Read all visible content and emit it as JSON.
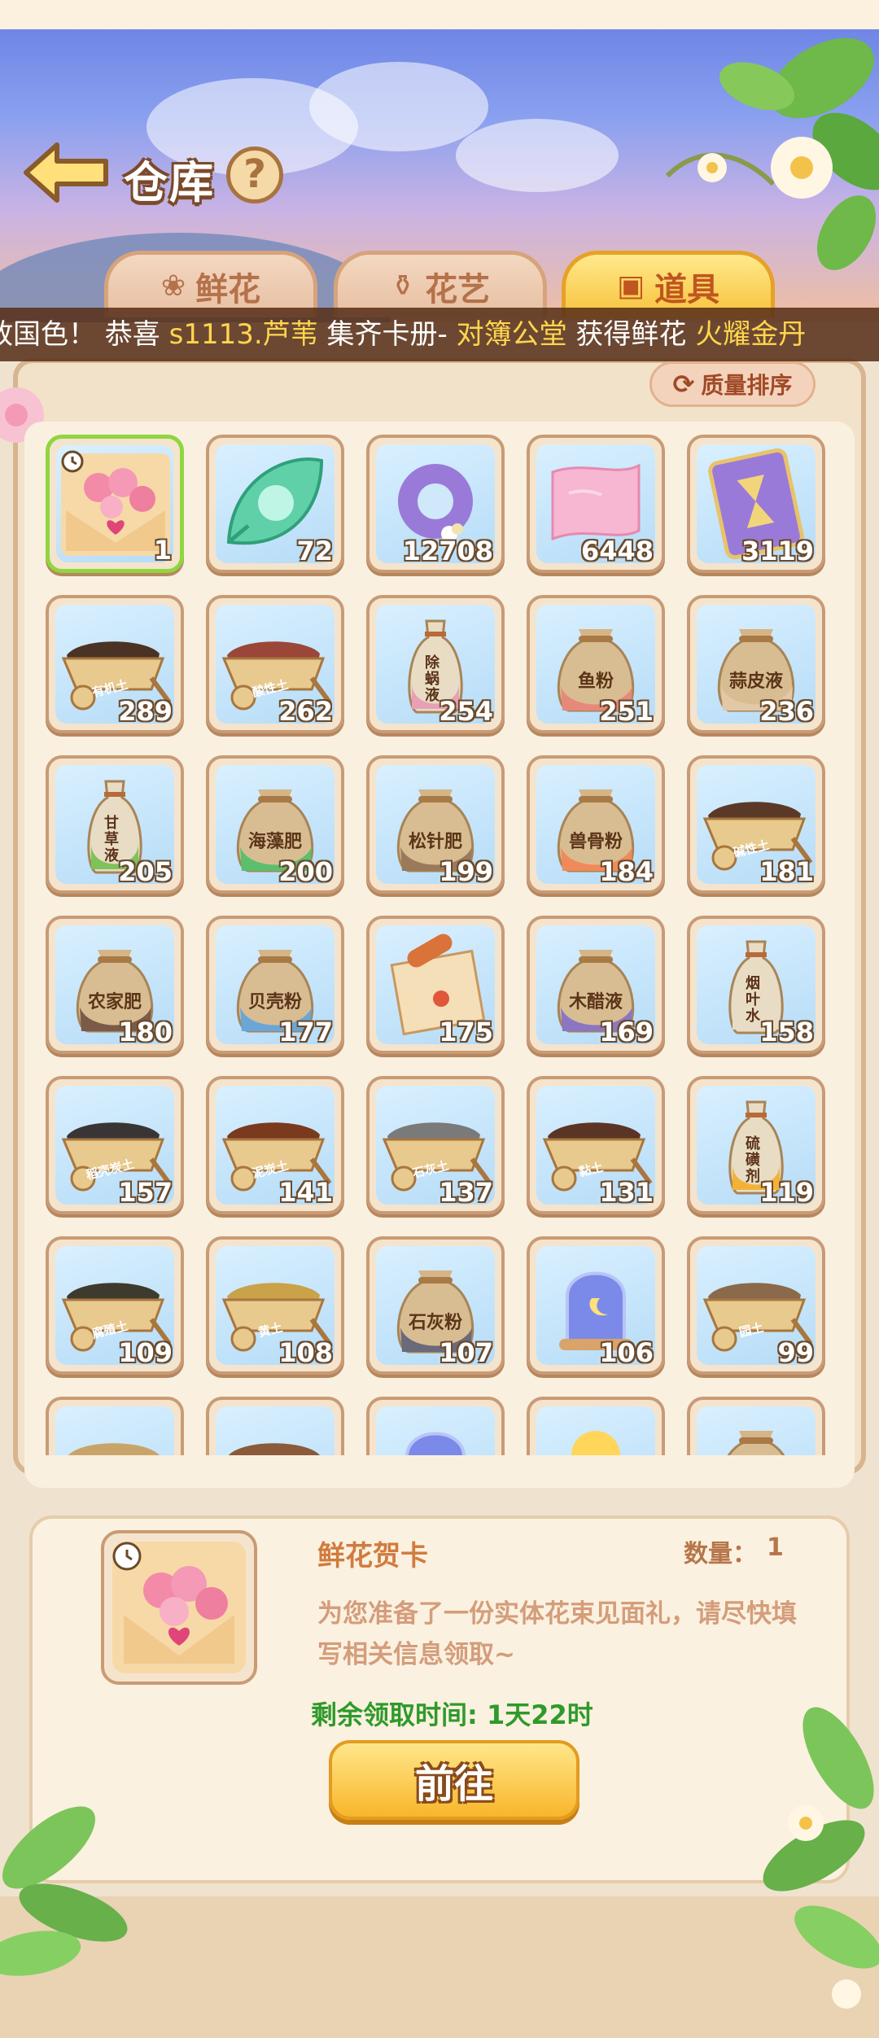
{
  "header": {
    "title": "仓库",
    "help_label": "?"
  },
  "tabs": [
    {
      "label": "鲜花",
      "icon": "rose-icon",
      "active": false
    },
    {
      "label": "花艺",
      "icon": "vase-icon",
      "active": false
    },
    {
      "label": "道具",
      "icon": "box-icon",
      "active": true
    }
  ],
  "marquee": {
    "part1": "绽放国色！ 恭喜 ",
    "user": "s1113.芦苇",
    "part2": " 集齐卡册- ",
    "album": "对簿公堂",
    "part3": " 获得鲜花 ",
    "flower": "火耀金丹"
  },
  "sort_label": "质量排序",
  "items": [
    {
      "type": "card",
      "count": "1",
      "selected": true,
      "label": ""
    },
    {
      "type": "leaf",
      "count": "72",
      "label": ""
    },
    {
      "type": "ring",
      "count": "12708",
      "label": ""
    },
    {
      "type": "scroll",
      "count": "6448",
      "label": ""
    },
    {
      "type": "hourglass",
      "count": "3119",
      "label": ""
    },
    {
      "type": "barrow",
      "count": "289",
      "label": "有机土",
      "soil": "#4a3324"
    },
    {
      "type": "barrow",
      "count": "262",
      "label": "酸性土",
      "soil": "#9a4638"
    },
    {
      "type": "bottle",
      "count": "254",
      "label": "除蜗液",
      "liquid": "#e7a0b6"
    },
    {
      "type": "bag",
      "count": "251",
      "label": "鱼粉",
      "base": "#e58a7a"
    },
    {
      "type": "bag",
      "count": "236",
      "label": "蒜皮液",
      "base": "#e3c8a8"
    },
    {
      "type": "bottle",
      "count": "205",
      "label": "甘草液",
      "liquid": "#7dc25a"
    },
    {
      "type": "bag",
      "count": "200",
      "label": "海藻肥",
      "base": "#5bbf6e"
    },
    {
      "type": "bag",
      "count": "199",
      "label": "松针肥",
      "base": "#9a7a5a"
    },
    {
      "type": "bag",
      "count": "184",
      "label": "兽骨粉",
      "base": "#f08a5a"
    },
    {
      "type": "barrow",
      "count": "181",
      "label": "碱性土",
      "soil": "#5a3a26"
    },
    {
      "type": "bag",
      "count": "180",
      "label": "农家肥",
      "base": "#7a5a48"
    },
    {
      "type": "bag",
      "count": "177",
      "label": "贝壳粉",
      "base": "#6aa6d8"
    },
    {
      "type": "paper",
      "count": "175",
      "label": ""
    },
    {
      "type": "bag",
      "count": "169",
      "label": "木醋液",
      "base": "#8a76c2"
    },
    {
      "type": "bottle",
      "count": "158",
      "label": "烟叶水",
      "liquid": "#e8dcc8"
    },
    {
      "type": "barrow",
      "count": "157",
      "label": "稻壳炭土",
      "soil": "#3a3535"
    },
    {
      "type": "barrow",
      "count": "141",
      "label": "泥炭土",
      "soil": "#7a3a1e"
    },
    {
      "type": "barrow",
      "count": "137",
      "label": "石灰土",
      "soil": "#7a7a7a"
    },
    {
      "type": "barrow",
      "count": "131",
      "label": "黏土",
      "soil": "#5a3526"
    },
    {
      "type": "bottle",
      "count": "119",
      "label": "硫磺剂",
      "liquid": "#f2b23a"
    },
    {
      "type": "barrow",
      "count": "109",
      "label": "腐殖土",
      "soil": "#3e3a2e"
    },
    {
      "type": "barrow",
      "count": "108",
      "label": "黄土",
      "soil": "#c9a24a"
    },
    {
      "type": "bag",
      "count": "107",
      "label": "石灰粉",
      "base": "#6a6a7a"
    },
    {
      "type": "dome",
      "count": "106",
      "label": ""
    },
    {
      "type": "barrow",
      "count": "99",
      "label": "园土",
      "soil": "#8a6a4a"
    },
    {
      "type": "barrow",
      "count": "",
      "label": "",
      "soil": "#c9a46a"
    },
    {
      "type": "barrow",
      "count": "",
      "label": "",
      "soil": "#8a5a3a"
    },
    {
      "type": "dome",
      "count": "",
      "label": ""
    },
    {
      "type": "sun",
      "count": "",
      "label": ""
    },
    {
      "type": "bag",
      "count": "",
      "label": "",
      "base": "#e3c8a8"
    }
  ],
  "detail": {
    "name": "鲜花贺卡",
    "qty_label": "数量：",
    "qty": "1",
    "desc": "为您准备了一份实体花束见面礼，请尽快填写相关信息领取~",
    "timer": "剩余领取时间: 1天22时",
    "go_label": "前往"
  },
  "colors": {
    "accent": "#f7c23b",
    "timer_green": "#2f9a2a",
    "label_orange": "#d17b3f"
  }
}
